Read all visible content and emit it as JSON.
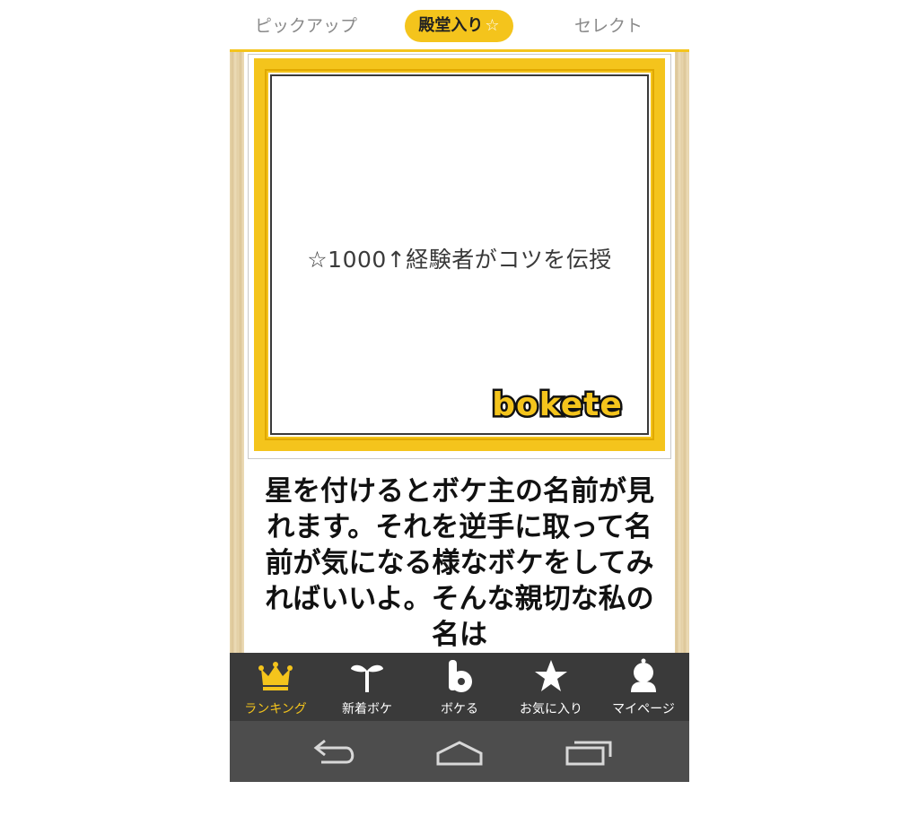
{
  "top_tabs": {
    "pickup": "ピックアップ",
    "hall_of_fame": "殿堂入り",
    "hall_of_fame_icon": "☆",
    "select": "セレクト"
  },
  "post": {
    "image_caption": "☆1000↑経験者がコツを伝授",
    "logo_text": "bokete",
    "boke_text": "星を付けるとボケ主の名前が見れます。それを逆手に取って名前が気になる様なボケをしてみればいいよ。そんな親切な私の名は"
  },
  "bottom_nav": {
    "items": [
      {
        "label": "ランキング",
        "icon": "crown-icon"
      },
      {
        "label": "新着ボケ",
        "icon": "sprout-icon"
      },
      {
        "label": "ボケる",
        "icon": "bokete-b-icon"
      },
      {
        "label": "お気に入り",
        "icon": "star-icon"
      },
      {
        "label": "マイページ",
        "icon": "user-bust-icon"
      }
    ]
  },
  "system_bar": {
    "buttons": [
      "back-icon",
      "home-icon",
      "recent-apps-icon"
    ]
  },
  "colors": {
    "accent": "#f4c41c",
    "nav_bg": "#3a3a3a",
    "system_bg": "#4d4d4d"
  }
}
